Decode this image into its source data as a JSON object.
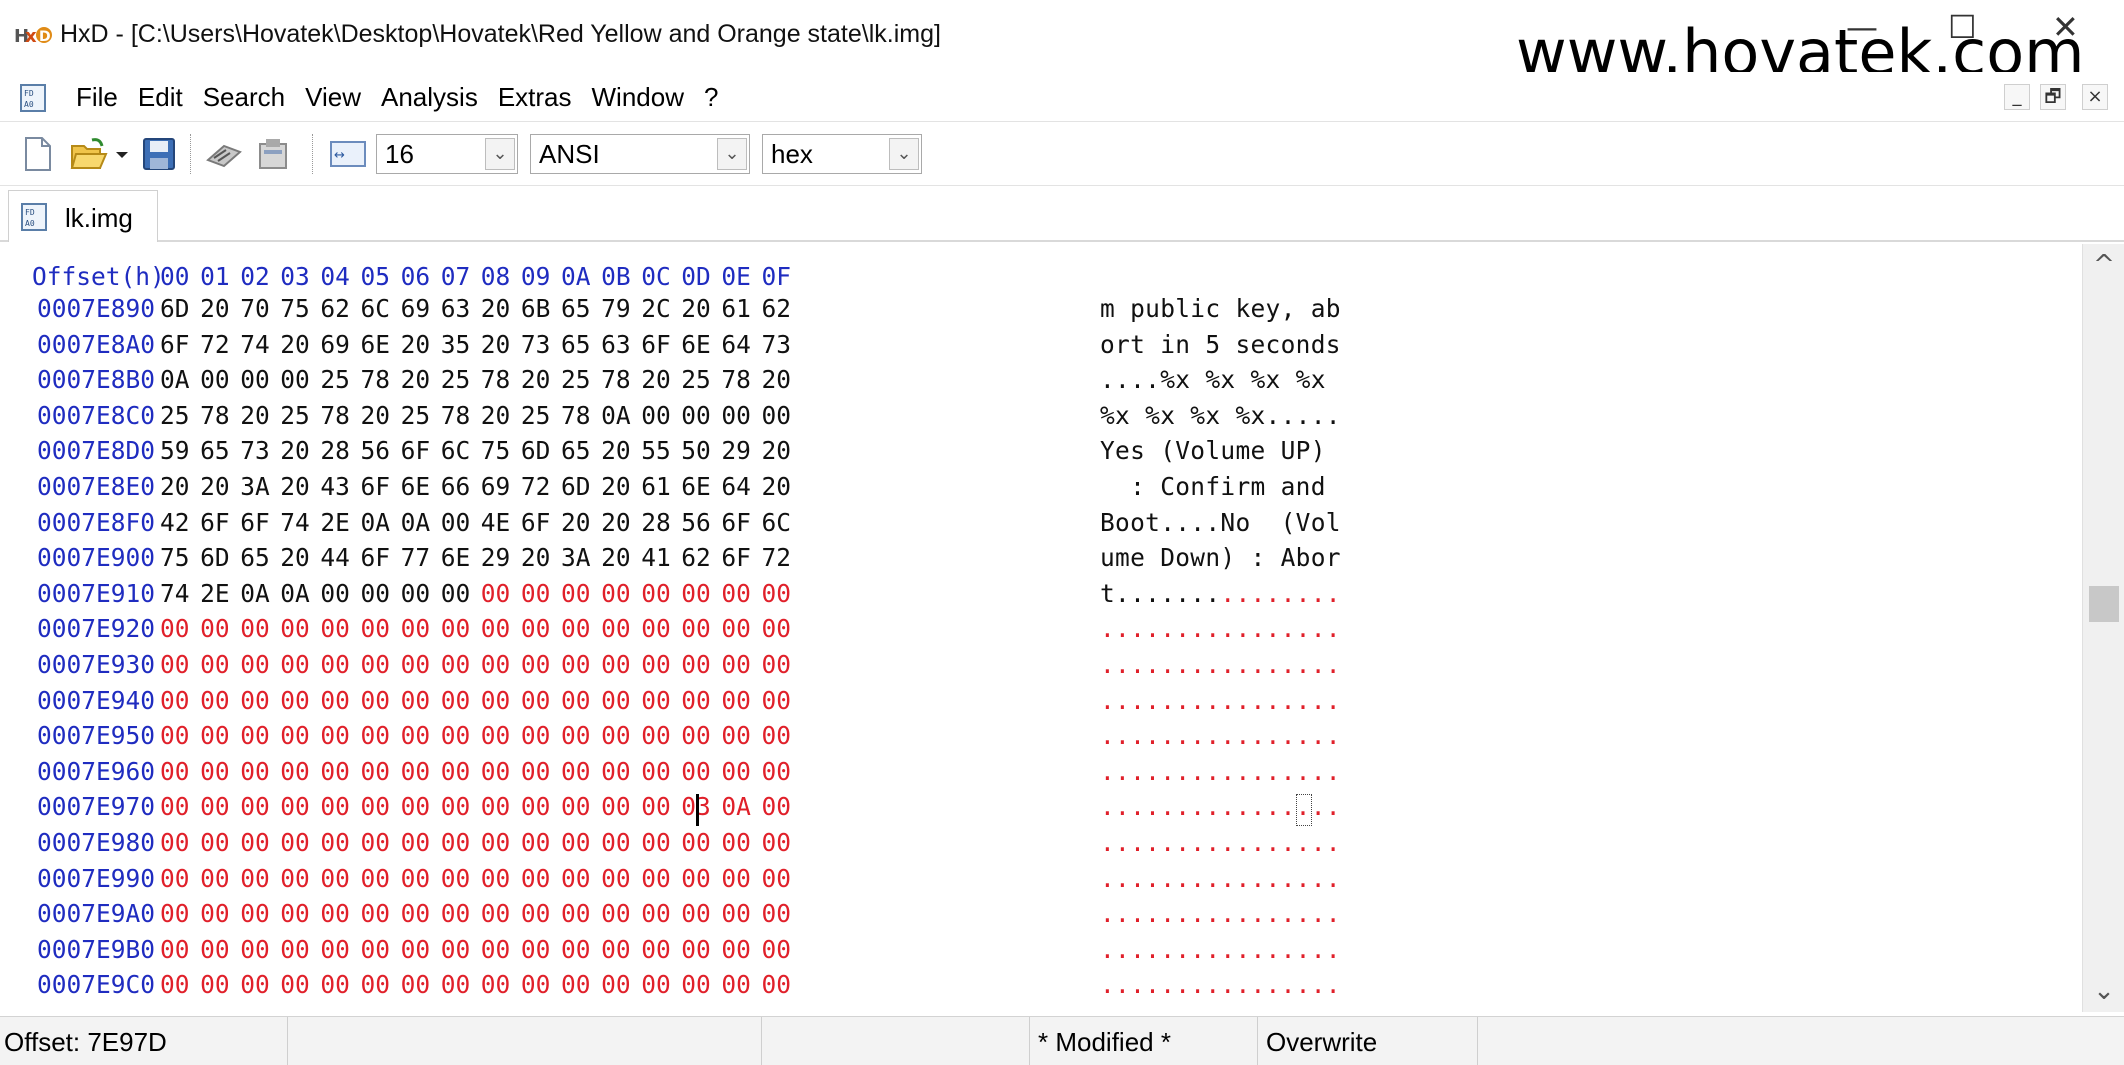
{
  "window": {
    "title": "HxD - [C:\\Users\\Hovatek\\Desktop\\Hovatek\\Red Yellow and Orange state\\lk.img]",
    "watermark": "www.hovatek.com",
    "minimize": "—",
    "maximize": "☐",
    "close": "✕"
  },
  "menu": {
    "items": [
      "File",
      "Edit",
      "Search",
      "View",
      "Analysis",
      "Extras",
      "Window",
      "?"
    ],
    "mdi_minimize": "_",
    "mdi_restore": "🗗",
    "mdi_close": "×"
  },
  "toolbar": {
    "bytes_per_row": "16",
    "charset": "ANSI",
    "offset_base": "hex",
    "dropdown_arrow": "⌄"
  },
  "tab": {
    "label": "lk.img"
  },
  "hex": {
    "header_offset": "Offset(h)",
    "columns": [
      "00",
      "01",
      "02",
      "03",
      "04",
      "05",
      "06",
      "07",
      "08",
      "09",
      "0A",
      "0B",
      "0C",
      "0D",
      "0E",
      "0F"
    ],
    "rows": [
      {
        "offset": "0007E890",
        "bytes": [
          "6D",
          "20",
          "70",
          "75",
          "62",
          "6C",
          "69",
          "63",
          "20",
          "6B",
          "65",
          "79",
          "2C",
          "20",
          "61",
          "62"
        ],
        "ascii": "m public key, ab"
      },
      {
        "offset": "0007E8A0",
        "bytes": [
          "6F",
          "72",
          "74",
          "20",
          "69",
          "6E",
          "20",
          "35",
          "20",
          "73",
          "65",
          "63",
          "6F",
          "6E",
          "64",
          "73"
        ],
        "ascii": "ort in 5 seconds"
      },
      {
        "offset": "0007E8B0",
        "bytes": [
          "0A",
          "00",
          "00",
          "00",
          "25",
          "78",
          "20",
          "25",
          "78",
          "20",
          "25",
          "78",
          "20",
          "25",
          "78",
          "20"
        ],
        "ascii": "....%x %x %x %x "
      },
      {
        "offset": "0007E8C0",
        "bytes": [
          "25",
          "78",
          "20",
          "25",
          "78",
          "20",
          "25",
          "78",
          "20",
          "25",
          "78",
          "0A",
          "00",
          "00",
          "00",
          "00"
        ],
        "ascii": "%x %x %x %x....."
      },
      {
        "offset": "0007E8D0",
        "bytes": [
          "59",
          "65",
          "73",
          "20",
          "28",
          "56",
          "6F",
          "6C",
          "75",
          "6D",
          "65",
          "20",
          "55",
          "50",
          "29",
          "20"
        ],
        "ascii": "Yes (Volume UP) "
      },
      {
        "offset": "0007E8E0",
        "bytes": [
          "20",
          "20",
          "3A",
          "20",
          "43",
          "6F",
          "6E",
          "66",
          "69",
          "72",
          "6D",
          "20",
          "61",
          "6E",
          "64",
          "20"
        ],
        "ascii": "  : Confirm and "
      },
      {
        "offset": "0007E8F0",
        "bytes": [
          "42",
          "6F",
          "6F",
          "74",
          "2E",
          "0A",
          "0A",
          "00",
          "4E",
          "6F",
          "20",
          "20",
          "28",
          "56",
          "6F",
          "6C"
        ],
        "ascii": "Boot....No  (Vol"
      },
      {
        "offset": "0007E900",
        "bytes": [
          "75",
          "6D",
          "65",
          "20",
          "44",
          "6F",
          "77",
          "6E",
          "29",
          "20",
          "3A",
          "20",
          "41",
          "62",
          "6F",
          "72"
        ],
        "ascii": "ume Down) : Abor"
      },
      {
        "offset": "0007E910",
        "bytes": [
          "74",
          "2E",
          "0A",
          "0A",
          "00",
          "00",
          "00",
          "00",
          "00",
          "00",
          "00",
          "00",
          "00",
          "00",
          "00",
          "00"
        ],
        "ascii": "t..............."
      },
      {
        "offset": "0007E920",
        "bytes": [
          "00",
          "00",
          "00",
          "00",
          "00",
          "00",
          "00",
          "00",
          "00",
          "00",
          "00",
          "00",
          "00",
          "00",
          "00",
          "00"
        ],
        "ascii": "................"
      },
      {
        "offset": "0007E930",
        "bytes": [
          "00",
          "00",
          "00",
          "00",
          "00",
          "00",
          "00",
          "00",
          "00",
          "00",
          "00",
          "00",
          "00",
          "00",
          "00",
          "00"
        ],
        "ascii": "................"
      },
      {
        "offset": "0007E940",
        "bytes": [
          "00",
          "00",
          "00",
          "00",
          "00",
          "00",
          "00",
          "00",
          "00",
          "00",
          "00",
          "00",
          "00",
          "00",
          "00",
          "00"
        ],
        "ascii": "................"
      },
      {
        "offset": "0007E950",
        "bytes": [
          "00",
          "00",
          "00",
          "00",
          "00",
          "00",
          "00",
          "00",
          "00",
          "00",
          "00",
          "00",
          "00",
          "00",
          "00",
          "00"
        ],
        "ascii": "................"
      },
      {
        "offset": "0007E960",
        "bytes": [
          "00",
          "00",
          "00",
          "00",
          "00",
          "00",
          "00",
          "00",
          "00",
          "00",
          "00",
          "00",
          "00",
          "00",
          "00",
          "00"
        ],
        "ascii": "................"
      },
      {
        "offset": "0007E970",
        "bytes": [
          "00",
          "00",
          "00",
          "00",
          "00",
          "00",
          "00",
          "00",
          "00",
          "00",
          "00",
          "00",
          "00",
          "03",
          "0A",
          "00"
        ],
        "ascii": "................"
      },
      {
        "offset": "0007E980",
        "bytes": [
          "00",
          "00",
          "00",
          "00",
          "00",
          "00",
          "00",
          "00",
          "00",
          "00",
          "00",
          "00",
          "00",
          "00",
          "00",
          "00"
        ],
        "ascii": "................"
      },
      {
        "offset": "0007E990",
        "bytes": [
          "00",
          "00",
          "00",
          "00",
          "00",
          "00",
          "00",
          "00",
          "00",
          "00",
          "00",
          "00",
          "00",
          "00",
          "00",
          "00"
        ],
        "ascii": "................"
      },
      {
        "offset": "0007E9A0",
        "bytes": [
          "00",
          "00",
          "00",
          "00",
          "00",
          "00",
          "00",
          "00",
          "00",
          "00",
          "00",
          "00",
          "00",
          "00",
          "00",
          "00"
        ],
        "ascii": "................"
      },
      {
        "offset": "0007E9B0",
        "bytes": [
          "00",
          "00",
          "00",
          "00",
          "00",
          "00",
          "00",
          "00",
          "00",
          "00",
          "00",
          "00",
          "00",
          "00",
          "00",
          "00"
        ],
        "ascii": "................"
      },
      {
        "offset": "0007E9C0",
        "bytes": [
          "00",
          "00",
          "00",
          "00",
          "00",
          "00",
          "00",
          "00",
          "00",
          "00",
          "00",
          "00",
          "00",
          "00",
          "00",
          "00"
        ],
        "ascii": "................"
      }
    ],
    "modified_color": "#e0202a",
    "normal_color": "#111111",
    "offset_color": "#1f2cc0",
    "first_modified_row": 8,
    "first_modified_col": 8,
    "caret_row": 14,
    "caret_col": 13
  },
  "scrollbar": {
    "up": "^",
    "down": "⌄"
  },
  "status": {
    "offset": "Offset: 7E97D",
    "modified": "* Modified *",
    "mode": "Overwrite"
  }
}
